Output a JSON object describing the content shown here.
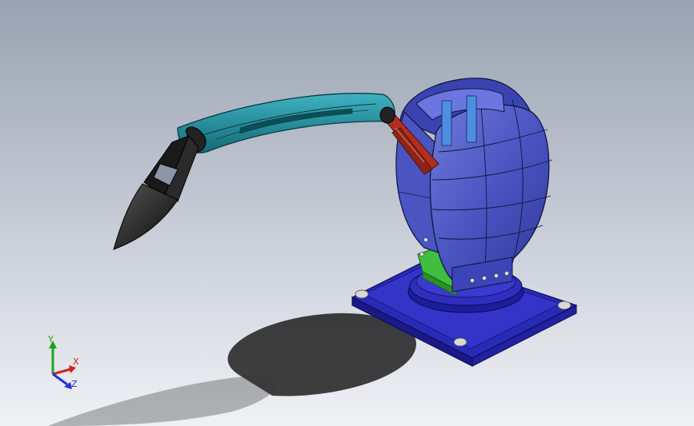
{
  "viewport": {
    "background_top": "#9aa3b2",
    "background_bottom": "#eef0f5"
  },
  "triad": {
    "x_label": "X",
    "y_label": "Y",
    "z_label": "Z",
    "x_color": "#d42020",
    "y_color": "#1fa31f",
    "z_color": "#2233cc"
  },
  "model": {
    "base_color": "#2a2ab5",
    "body_color": "#4b57c8",
    "arm_color": "#1f8a99",
    "link_color": "#b03020",
    "gripper_color": "#1a1a1a",
    "green_part_color": "#3fbf3f"
  }
}
